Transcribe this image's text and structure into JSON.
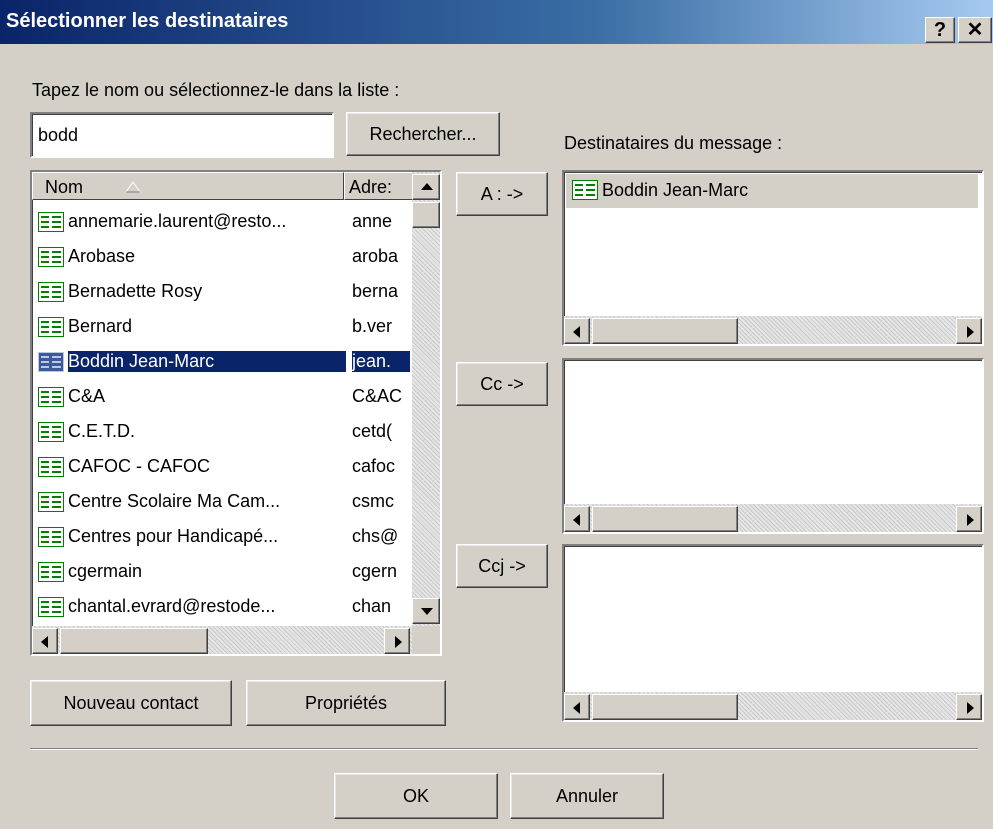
{
  "dialog": {
    "title": "Sélectionner les destinataires",
    "help_label": "?",
    "close_label": "✕"
  },
  "search": {
    "prompt_label": "Tapez le nom ou sélectionnez-le dans la liste :",
    "value": "bodd",
    "find_button": "Rechercher..."
  },
  "contacts": {
    "columns": [
      "Nom",
      "Adresse"
    ],
    "rows": [
      {
        "name": "annemarie.laurent@resto...",
        "address": "anne"
      },
      {
        "name": "Arobase",
        "address": "aroba"
      },
      {
        "name": "Bernadette Rosy",
        "address": "berna"
      },
      {
        "name": "Bernard",
        "address": "b.ver"
      },
      {
        "name": "Boddin Jean-Marc",
        "address": "jean.",
        "selected": true
      },
      {
        "name": "C&A",
        "address": "C&AC"
      },
      {
        "name": "C.E.T.D.",
        "address": "cetd("
      },
      {
        "name": "CAFOC - CAFOC",
        "address": "cafoc"
      },
      {
        "name": "Centre Scolaire Ma Cam...",
        "address": "csmc"
      },
      {
        "name": "Centres pour Handicapé...",
        "address": "chs@"
      },
      {
        "name": "cgermain",
        "address": "cgern"
      },
      {
        "name": "chantal.evrard@restode...",
        "address": "chan"
      }
    ],
    "header_name": "Nom",
    "header_address": "Adre:"
  },
  "actions": {
    "to_button": "A : ->",
    "cc_button": "Cc ->",
    "bcc_button": "Ccj ->",
    "new_contact_button": "Nouveau contact",
    "properties_button": "Propriétés",
    "ok_button": "OK",
    "cancel_button": "Annuler"
  },
  "recipients": {
    "label": "Destinataires du message :",
    "to": [
      "Boddin Jean-Marc"
    ],
    "cc": [],
    "bcc": []
  },
  "icons": {
    "contact": "contact-card-icon",
    "sort": "sort-ascending-icon",
    "scroll_up": "arrow-up-icon",
    "scroll_down": "arrow-down-icon",
    "scroll_left": "arrow-left-icon",
    "scroll_right": "arrow-right-icon"
  },
  "colors": {
    "selection": "#0a246a",
    "title_start": "#0a246a",
    "title_end": "#a6caf0",
    "face": "#d4d0c8"
  }
}
